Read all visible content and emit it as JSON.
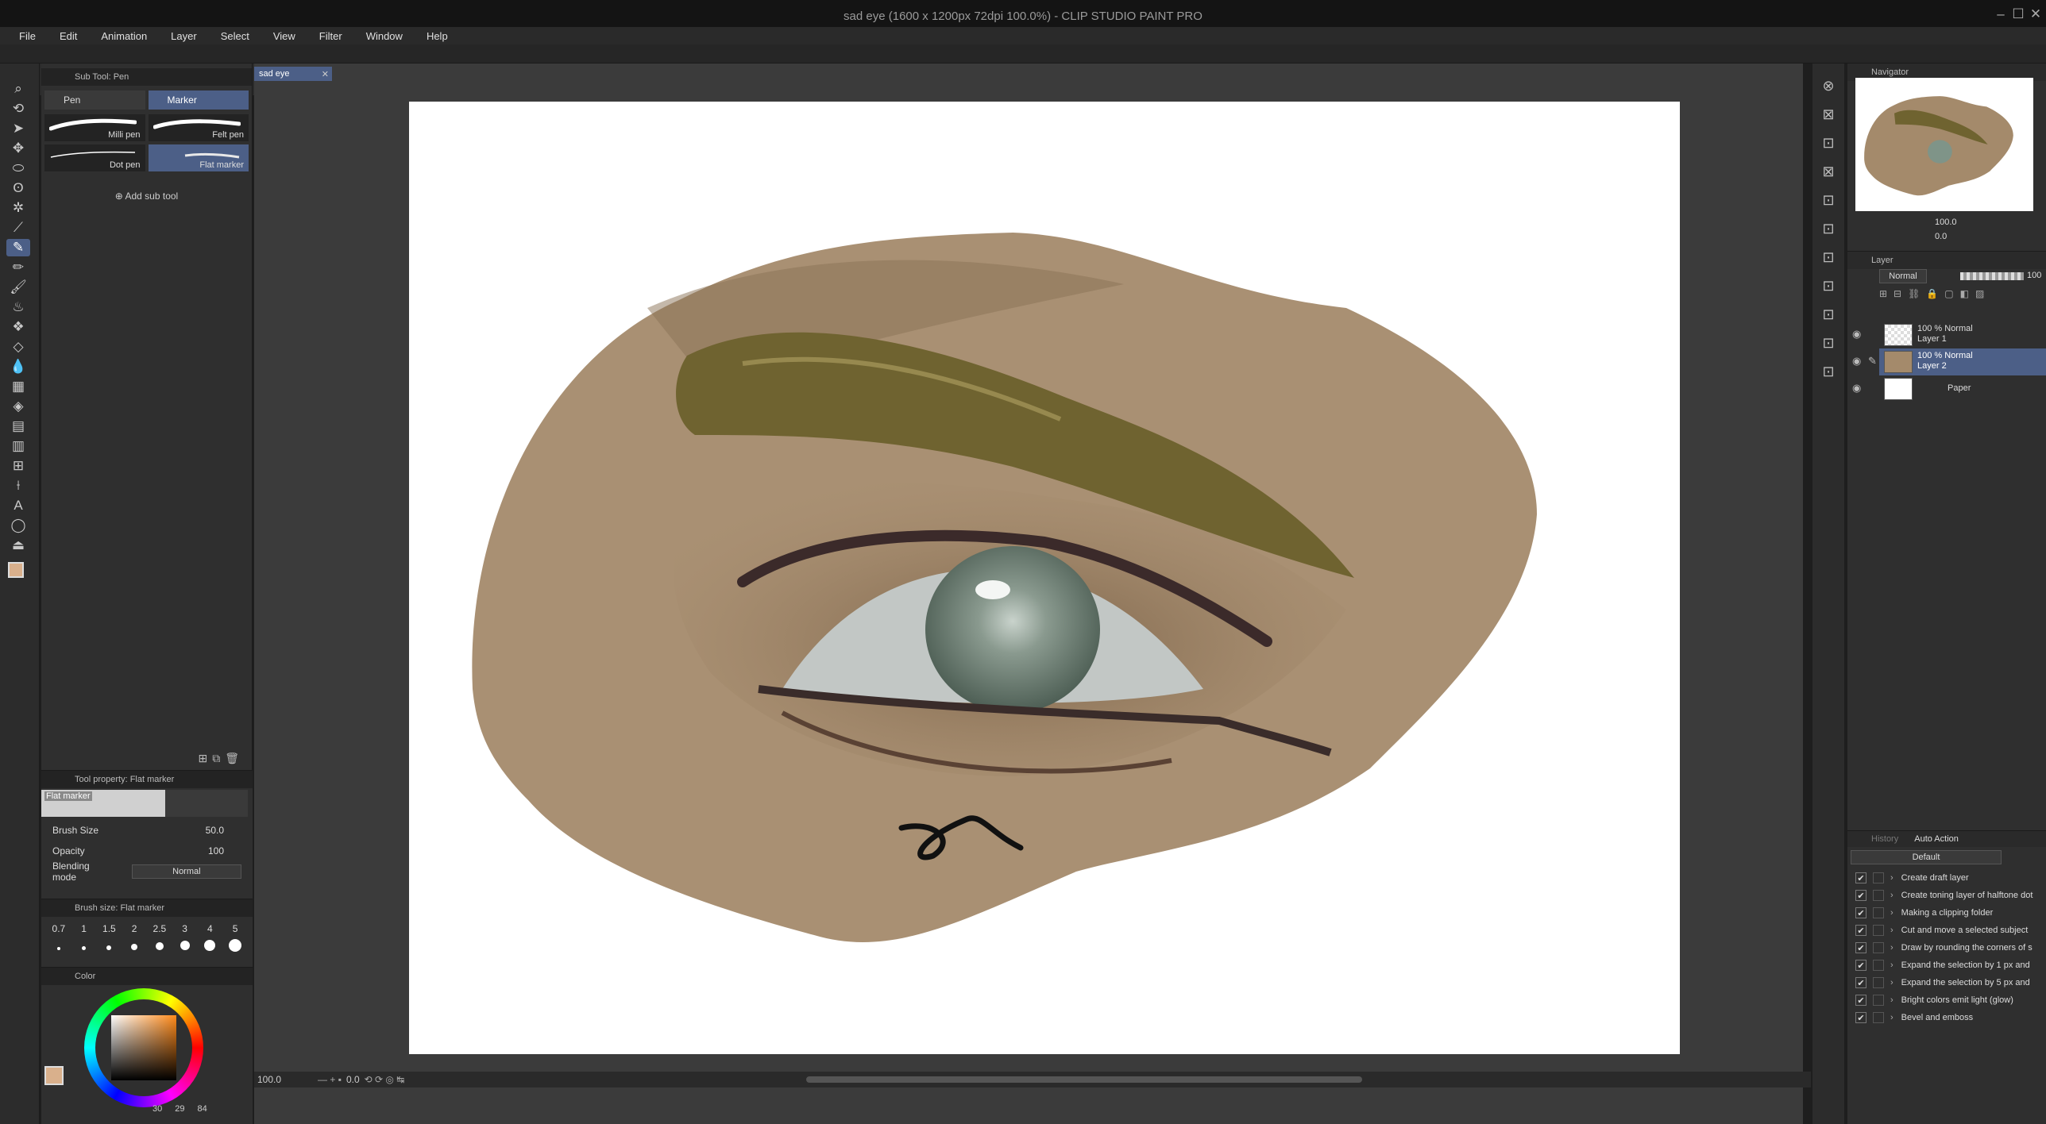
{
  "window": {
    "title": "sad eye (1600 x 1200px 72dpi 100.0%) - CLIP STUDIO PAINT PRO"
  },
  "menu": [
    "File",
    "Edit",
    "Animation",
    "Layer",
    "Select",
    "View",
    "Filter",
    "Window",
    "Help"
  ],
  "document_tab": {
    "name": "sad eye"
  },
  "subtool": {
    "panel_title": "Sub Tool: Pen",
    "groups": [
      "Pen",
      "Marker"
    ],
    "brushes": [
      "Milli pen",
      "Felt pen",
      "Dot pen",
      "Flat marker"
    ],
    "add_label": "Add sub tool"
  },
  "tool_property": {
    "title": "Tool property: Flat marker",
    "preview_label": "Flat marker",
    "brush_size_label": "Brush Size",
    "brush_size_value": "50.0",
    "opacity_label": "Opacity",
    "opacity_value": "100",
    "blend_label": "Blending mode",
    "blend_value": "Normal"
  },
  "brush_size_panel": {
    "title": "Brush size: Flat marker",
    "sizes": [
      "0.7",
      "1",
      "1.5",
      "2",
      "2.5",
      "3",
      "4",
      "5"
    ]
  },
  "color_panel": {
    "title": "Color",
    "readout": [
      "30",
      "29",
      "84"
    ],
    "main_color": "#d9b08c"
  },
  "navigator": {
    "title": "Navigator",
    "zoom": "100.0",
    "rotate": "0.0"
  },
  "layer_panel": {
    "title": "Layer",
    "blend_mode": "Normal",
    "opacity": "100",
    "layers": [
      {
        "mode": "100 % Normal",
        "name": "Layer 1"
      },
      {
        "mode": "100 % Normal",
        "name": "Layer 2"
      },
      {
        "mode": "",
        "name": "Paper"
      }
    ]
  },
  "auto_action": {
    "tab_inactive": "History",
    "title": "Auto Action",
    "set": "Default",
    "actions": [
      "Create draft layer",
      "Create toning layer of halftone dot",
      "Making a clipping folder",
      "Cut and move a selected subject",
      "Draw by rounding the corners of s",
      "Expand the selection by 1 px and",
      "Expand the selection by 5 px and",
      "Bright colors emit light (glow)",
      "Bevel and emboss"
    ]
  },
  "status": {
    "zoom": "100.0",
    "angle": "0.0"
  },
  "colors": {
    "accent": "#4c5f87",
    "skin": "#a48a6b",
    "brow": "#6f6330",
    "iris": "#7f9488"
  }
}
